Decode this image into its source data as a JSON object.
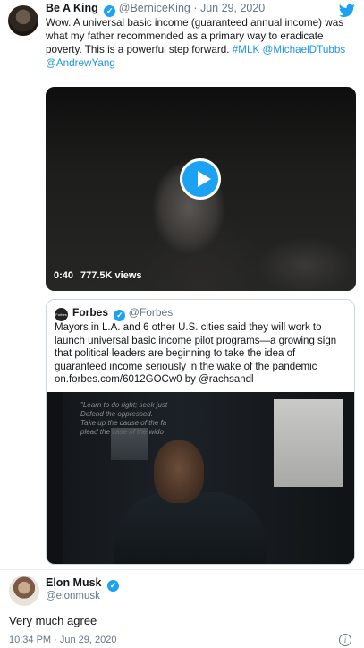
{
  "tweet": {
    "author_name": "Be A King",
    "author_handle": "@BerniceKing",
    "date": "· Jun 29, 2020",
    "text_plain": "Wow. A universal basic income (guaranteed annual income) was what my father recommended as a primary way to eradicate poverty. This is a powerful step forward.",
    "links": [
      "#MLK",
      "@MichaelDTubbs",
      "@AndrewYang"
    ],
    "video": {
      "duration": "0:40",
      "views": "777.5K views"
    }
  },
  "quoted": {
    "author_name": "Forbes",
    "author_handle": "@Forbes",
    "text": "Mayors in L.A. and 6 other U.S. cities said they will work to launch universal basic income pilot programs—a growing sign that political leaders are beginning to take the idea of guaranteed income seriously in the wake of the pandemic on.forbes.com/6012GOCw0 by @rachsandl",
    "avatar_text": "Forbes",
    "image_wall_text": "\"Learn to do right; seek just\nDefend the oppressed.\nTake up the cause of the fa\nplead the case of the wido"
  },
  "reply": {
    "author_name": "Elon Musk",
    "author_handle": "@elonmusk",
    "text": "Very much agree",
    "timestamp": "10:34 PM · Jun 29, 2020"
  },
  "colors": {
    "accent": "#1da1f2",
    "link": "#1b95e0",
    "muted": "#657786"
  },
  "icons": [
    "twitter-bird-icon",
    "verified-badge-icon",
    "play-icon",
    "info-icon"
  ]
}
